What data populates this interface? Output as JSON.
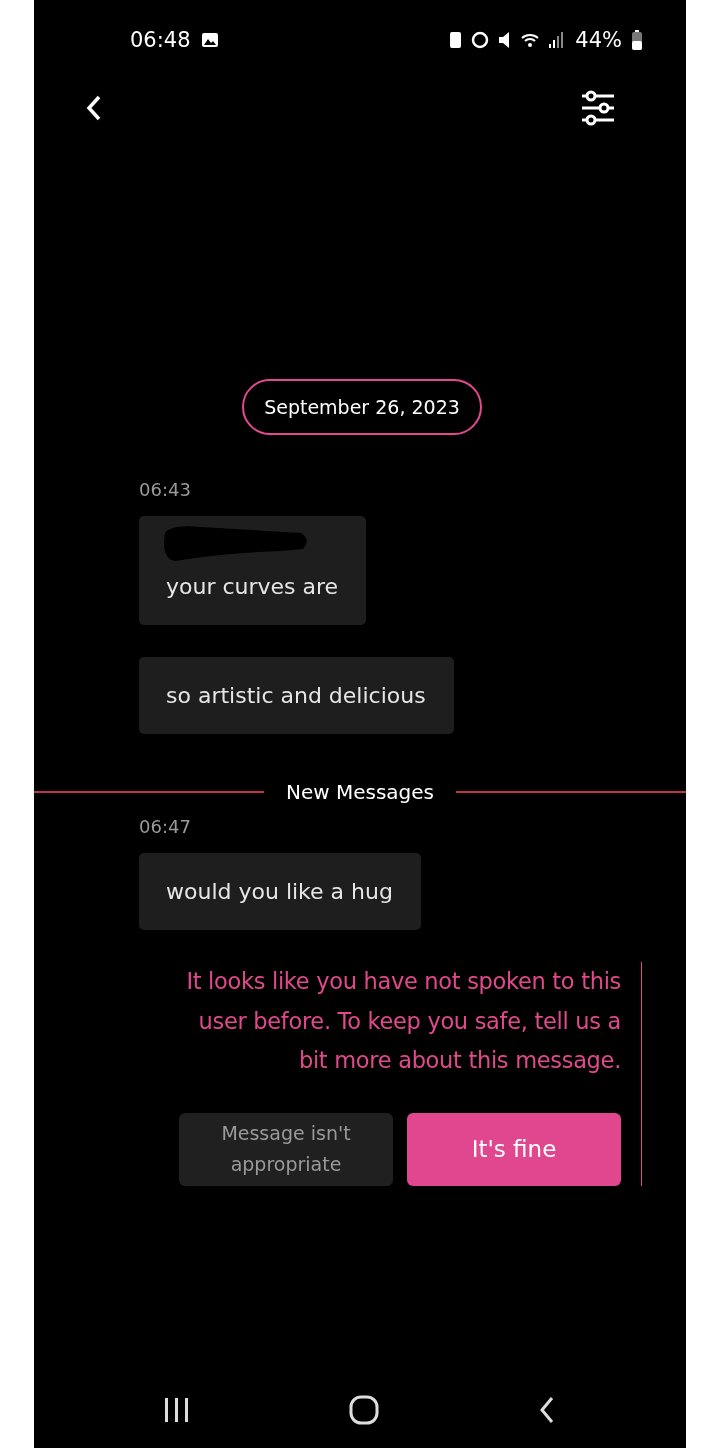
{
  "status_bar": {
    "time": "06:48",
    "battery": "44%"
  },
  "date_chip": "September 26, 2023",
  "groups": [
    {
      "time": "06:43",
      "messages": [
        {
          "text": "your curves are",
          "redacted": true
        },
        {
          "text": "so artistic and delicious",
          "redacted": false
        }
      ]
    },
    {
      "divider": "New Messages",
      "time": "06:47",
      "messages": [
        {
          "text": "would you like a hug",
          "redacted": false
        }
      ]
    }
  ],
  "safety_prompt": {
    "text": "It looks like you have not spoken to this user before. To keep you safe, tell us a bit more about this message.",
    "buttons": [
      {
        "label": "Message isn't appropriate",
        "kind": "secondary"
      },
      {
        "label": "It's fine",
        "kind": "primary"
      }
    ]
  }
}
